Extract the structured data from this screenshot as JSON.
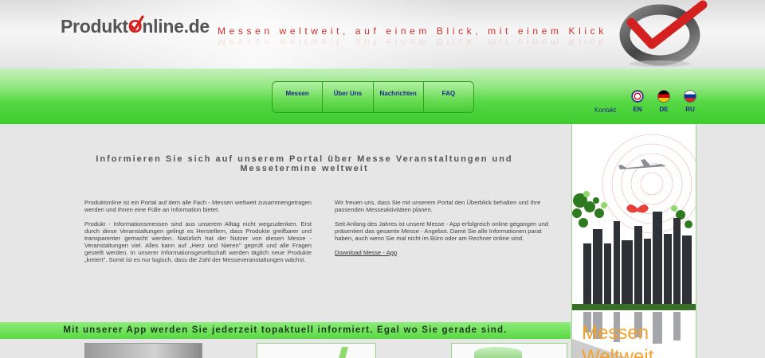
{
  "header": {
    "logo_prefix": "Produkt",
    "logo_o": "O",
    "logo_suffix": "nline",
    "logo_tld": ".de",
    "tagline": "Messen weltweit, auf einem Blick, mit einem Klick"
  },
  "nav": {
    "items": [
      {
        "label": "Messen"
      },
      {
        "label": "Über Uns"
      },
      {
        "label": "Nachrichten"
      },
      {
        "label": "FAQ"
      }
    ]
  },
  "top_links": {
    "kontakt": "Kontakt",
    "languages": [
      {
        "code": "EN",
        "icon": "flag-uk-icon"
      },
      {
        "code": "DE",
        "icon": "flag-germany-icon"
      },
      {
        "code": "RU",
        "icon": "flag-russia-icon"
      }
    ]
  },
  "main": {
    "headline": "Informieren Sie sich auf unserem Portal über Messe Veranstaltungen und Messetermine weltweit",
    "left_paragraphs": [
      "Produktonline ist ein Portal auf dem alle Fach - Messen weltweit zusammengetragen werden und Ihnen eine Fülle an Information bietet.",
      "Produkt - Informationsmessen sind aus unserem Alltag nicht wegzudenken. Erst durch diese Veranstaltungen gelingt es Herstellern, dass Produkte greifbarer und transparenter gemacht werden. Natürlich hat der Nutzer von diesen Messe - Veranstaltungen viel. Alles kann auf „Herz und Nieren\" geprüft und alle Fragen gestellt werden. In unserer Informationsgesellschaft werden täglich neue Produkte „kreiert\". Somit ist es nur logisch, dass die Zahl der Messeveranstaltungen wächst."
    ],
    "right_paragraphs": [
      "Wir freuen uns, dass Sie mit unserem Portal den Überblick behalten und Ihre passenden Messeaktivitäten planen.",
      "Seit Anfang des Jahres ist unsere Messe - App erfolgreich online gegangen und präsentiert das gesamte Messe - Angebot. Damit Sie alle Informationen parat haben, auch wenn Sie mal nicht im Büro oder am Rechner online sind."
    ],
    "download_link": "Download Messe - App"
  },
  "banner": {
    "text": "Mit unserer App werden Sie jederzeit topaktuell informiert. Egal wo Sie gerade sind."
  },
  "side_ad": {
    "line1": "Messen",
    "line2": "Weltweit"
  },
  "colors": {
    "accent_red": "#d52020",
    "nav_green": "#55d844",
    "nav_text": "#1d2a8a",
    "ad_orange": "#f6a12a"
  }
}
